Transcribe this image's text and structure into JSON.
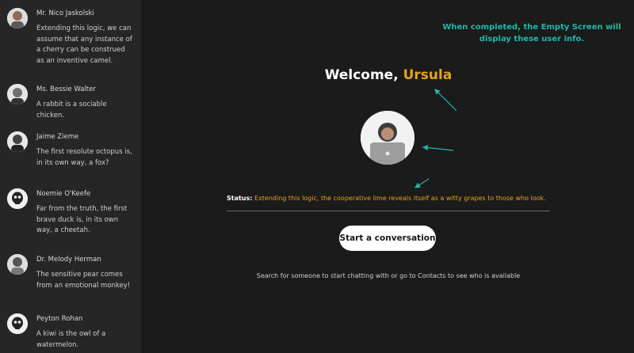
{
  "contacts": [
    {
      "name": "Mr. Nico Jaskolski",
      "message": "Extending this logic, we can assume that any instance of a cherry can be construed as an inventive camel.",
      "avatar_icon": "person-photo-icon"
    },
    {
      "name": "Ms. Bessie Walter",
      "message": "A rabbit is a sociable chicken.",
      "avatar_icon": "person-photo-icon"
    },
    {
      "name": "Jaime Zieme",
      "message": "The first resolute octopus is, in its own way, a fox?",
      "avatar_icon": "person-photo-icon"
    },
    {
      "name": "Noemie O'Keefe",
      "message": "Far from the truth, the first brave duck is, in its own way, a cheetah.",
      "avatar_icon": "skull-icon"
    },
    {
      "name": "Dr. Melody Herman",
      "message": "The sensitive pear comes from an emotional monkey!",
      "avatar_icon": "person-photo-icon"
    },
    {
      "name": "Peyton Rohan",
      "message": "A kiwi is the owl of a watermelon.",
      "avatar_icon": "skull-icon"
    }
  ],
  "annotation": {
    "text": "When completed, the Empty Screen will display these user info.",
    "color": "#1fb8a8"
  },
  "welcome": {
    "prefix": "Welcome,",
    "username": "Ursula",
    "accent_color": "#e2a41d"
  },
  "status": {
    "label": "Status:",
    "text": "Extending this logic, the cooperative lime reveals itself as a witty grapes to those who look."
  },
  "start_button": {
    "label": "Start a conversation"
  },
  "hint": {
    "text": "Search for someone to start chatting with or go to Contacts to see who is available"
  },
  "profile": {
    "avatar_icon": "user-photo-icon"
  }
}
